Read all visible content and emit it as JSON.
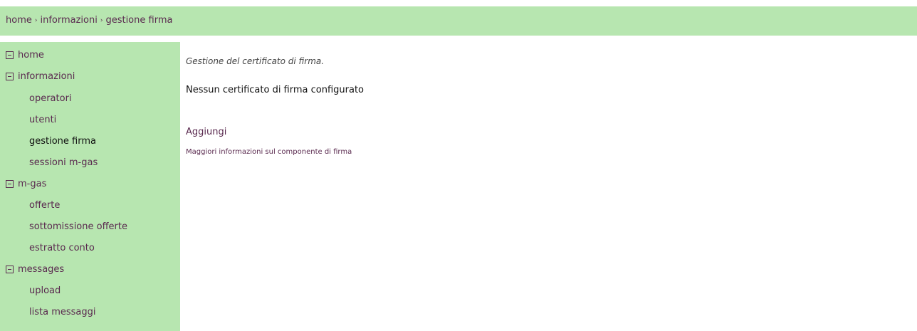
{
  "breadcrumb": {
    "items": [
      "home",
      "informazioni",
      "gestione firma"
    ],
    "separator": "›"
  },
  "sidebar": {
    "home": "home",
    "informazioni": {
      "label": "informazioni",
      "items": [
        "operatori",
        "utenti",
        "gestione firma",
        "sessioni m-gas"
      ]
    },
    "mgas": {
      "label": "m-gas",
      "items": [
        "offerte",
        "sottomissione offerte",
        "estratto conto"
      ]
    },
    "messages": {
      "label": "messages",
      "items": [
        "upload",
        "lista messaggi"
      ]
    },
    "active_item": "gestione firma",
    "group_icon": "collapse-box-icon"
  },
  "main": {
    "description": "Gestione del certificato di firma.",
    "status": "Nessun certificato di firma configurato",
    "add_link": "Aggiungi",
    "info_link": "Maggiori informazioni sul componente di firma"
  },
  "colors": {
    "green_background": "#b7e6b0",
    "link_text": "#5a2a4f",
    "active_text": "#111111"
  }
}
